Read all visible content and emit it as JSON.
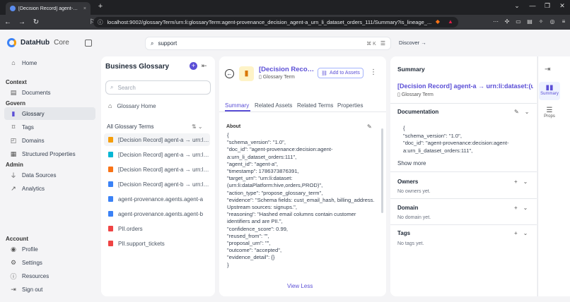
{
  "browser": {
    "tab_title": "[Decision Record] agent-a → urn:li",
    "url": "localhost:9002/glossaryTerm/urn:li:glossaryTerm:agent-provenance_decision_agent-a_urn_li_dataset_orders_111/Summary?is_lineage_..."
  },
  "app": {
    "brand": "DataHub",
    "edition": "Core",
    "search_value": "support",
    "search_shortcut": "⌘ K",
    "discover_label": "Discover →"
  },
  "sidebar": {
    "home": "Home",
    "context_header": "Context",
    "documents": "Documents",
    "govern_header": "Govern",
    "glossary": "Glossary",
    "tags": "Tags",
    "domains": "Domains",
    "structured_properties": "Structured Properties",
    "admin_header": "Admin",
    "data_sources": "Data Sources",
    "analytics": "Analytics",
    "account_header": "Account",
    "profile": "Profile",
    "settings": "Settings",
    "resources": "Resources",
    "sign_out": "Sign out"
  },
  "glossary": {
    "title": "Business Glossary",
    "search_placeholder": "Search",
    "home_label": "Glossary Home",
    "all_terms_label": "All Glossary Terms",
    "items": [
      {
        "label": "[Decision Record] agent-a → urn:li:dataset...",
        "color": "#f59e0b"
      },
      {
        "label": "[Decision Record] agent-a → urn:li:dataset...",
        "color": "#06b6d4"
      },
      {
        "label": "[Decision Record] agent-a → urn:li:dataset...",
        "color": "#f97316"
      },
      {
        "label": "[Decision Record] agent-b → urn:li:dataset...",
        "color": "#3b82f6"
      },
      {
        "label": "agent-provenance.agents.agent-a",
        "color": "#3b82f6"
      },
      {
        "label": "agent-provenance.agents.agent-b",
        "color": "#3b82f6"
      },
      {
        "label": "PII.orders",
        "color": "#ef4444"
      },
      {
        "label": "PII.support_tickets",
        "color": "#ef4444"
      }
    ]
  },
  "entity": {
    "title": "[Decision Record] agent-a → urn:li:dataset",
    "type": "Glossary Term",
    "add_assets": "Add to Assets",
    "tabs": [
      "Summary",
      "Related Assets",
      "Related Terms",
      "Properties"
    ],
    "about_label": "About",
    "about_json": "{\n\"schema_version\": \"1.0\",\n\"doc_id\": \"agent-provenance:decision:agent-a:urn_li_dataset_orders:111\",\n\"agent_id\": \"agent-a\",\n\"timestamp\": 1786373876391,\n\"target_urn\": \"urn:li:dataset:(urn:li:dataPlatform:hive,orders,PROD)\",\n\"action_type\": \"propose_glossary_term\",\n\"evidence\": \"Schema fields: cust_email_hash, billing_address. Upstream sources: signups.\",\n\"reasoning\": \"Hashed email columns contain customer identifiers and are PII.\",\n\"confidence_score\": 0.99,\n\"reused_from\": \"\",\n\"proposal_urn\": \"\",\n\"outcome\": \"accepted\",\n\"evidence_detail\": {}\n}",
    "view_less": "View Less"
  },
  "summary": {
    "title": "Summary",
    "name": "[Decision Record] agent-a → urn:li:dataset:(urn",
    "type": "Glossary Term",
    "documentation_label": "Documentation",
    "doc_json": "{\n\"schema_version\": \"1.0\",\n\"doc_id\": \"agent-provenance:decision:agent-a:urn_li_dataset_orders:111\",",
    "show_more": "Show more",
    "owners_label": "Owners",
    "owners_empty": "No owners yet.",
    "domain_label": "Domain",
    "domain_empty": "No domain yet.",
    "tags_label": "Tags",
    "tags_empty": "No tags yet."
  },
  "rail": {
    "summary": "Summary",
    "props": "Props"
  }
}
